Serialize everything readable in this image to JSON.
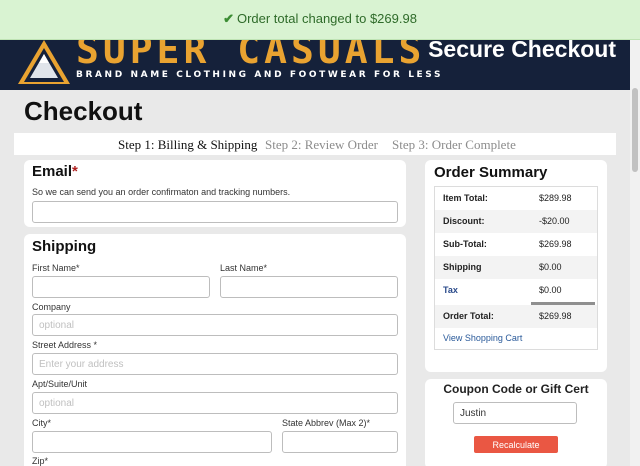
{
  "toast": {
    "icon": "check-icon",
    "message": "Order total changed to $269.98"
  },
  "header": {
    "logo_text": "SUPER CASUALS",
    "tagline": "BRAND NAME CLOTHING AND FOOTWEAR FOR LESS",
    "secure_label": "Secure Checkout"
  },
  "page": {
    "title": "Checkout"
  },
  "steps": [
    {
      "label": "Step 1: Billing & Shipping"
    },
    {
      "label": "Step 2: Review Order"
    },
    {
      "label": "Step 3: Order Complete"
    }
  ],
  "email": {
    "heading": "Email",
    "required_mark": "*",
    "helper": "So we can send you an order confirmaton and tracking numbers.",
    "value": ""
  },
  "shipping": {
    "heading": "Shipping",
    "first_name_label": "First Name*",
    "last_name_label": "Last Name*",
    "company_label": "Company",
    "company_placeholder": "optional",
    "street_label": "Street Address *",
    "street_placeholder": "Enter your address",
    "apt_label": "Apt/Suite/Unit",
    "apt_placeholder": "optional",
    "city_label": "City*",
    "state_label": "State Abbrev (Max 2)*",
    "zip_label": "Zip*"
  },
  "summary": {
    "heading": "Order Summary",
    "rows": [
      {
        "label": "Item Total:",
        "value": "$289.98"
      },
      {
        "label": "Discount:",
        "value": "-$20.00"
      },
      {
        "label": "Sub-Total:",
        "value": "$269.98"
      },
      {
        "label": "Shipping",
        "value": "$0.00"
      },
      {
        "label": "Tax",
        "value": "$0.00"
      },
      {
        "label": "Order Total:",
        "value": "$269.98"
      }
    ],
    "cart_link": "View Shopping Cart"
  },
  "coupon": {
    "heading": "Coupon Code or Gift Cert",
    "value": "Justin",
    "button_label": "Recalculate"
  },
  "colors": {
    "header_bg": "#15213a",
    "logo_orange": "#e9a331",
    "toast_bg": "#d9f3d2",
    "toast_text": "#2f6b2a",
    "link": "#2a5a9a",
    "button": "#ea5743"
  }
}
